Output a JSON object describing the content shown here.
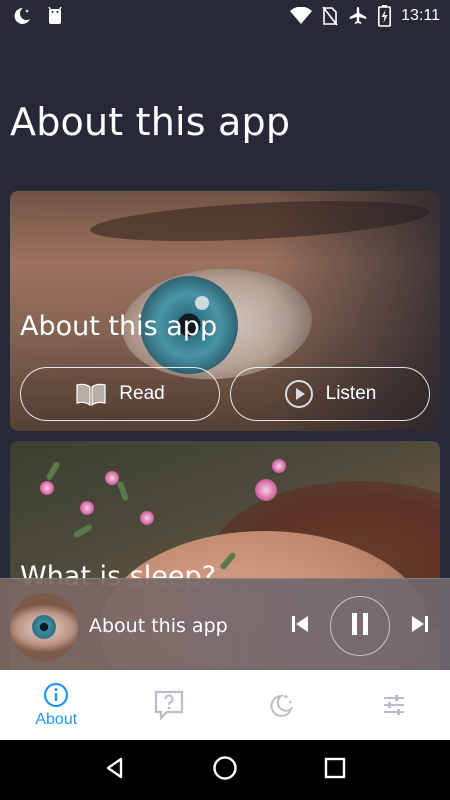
{
  "status_bar": {
    "time": "13:11",
    "left_icons": [
      "night-mode-icon",
      "android-icon"
    ],
    "right_icons": [
      "wifi-icon",
      "no-sim-icon",
      "airplane-icon",
      "battery-icon"
    ]
  },
  "page": {
    "title": "About this app"
  },
  "cards": [
    {
      "title": "About this app",
      "read_label": "Read",
      "listen_label": "Listen"
    },
    {
      "title": "What is sleep?"
    }
  ],
  "player": {
    "title": "About this app",
    "state": "playing"
  },
  "tabs": [
    {
      "label": "About",
      "icon": "info-icon",
      "active": true
    },
    {
      "label": "",
      "icon": "question-icon",
      "active": false
    },
    {
      "label": "",
      "icon": "moon-stars-icon",
      "active": false
    },
    {
      "label": "",
      "icon": "sliders-icon",
      "active": false
    }
  ],
  "nav": {
    "icons": [
      "back-icon",
      "home-icon",
      "recents-icon"
    ]
  },
  "colors": {
    "background": "#262a37",
    "accent": "#2196f3",
    "tab_inactive": "#b9bec6"
  }
}
